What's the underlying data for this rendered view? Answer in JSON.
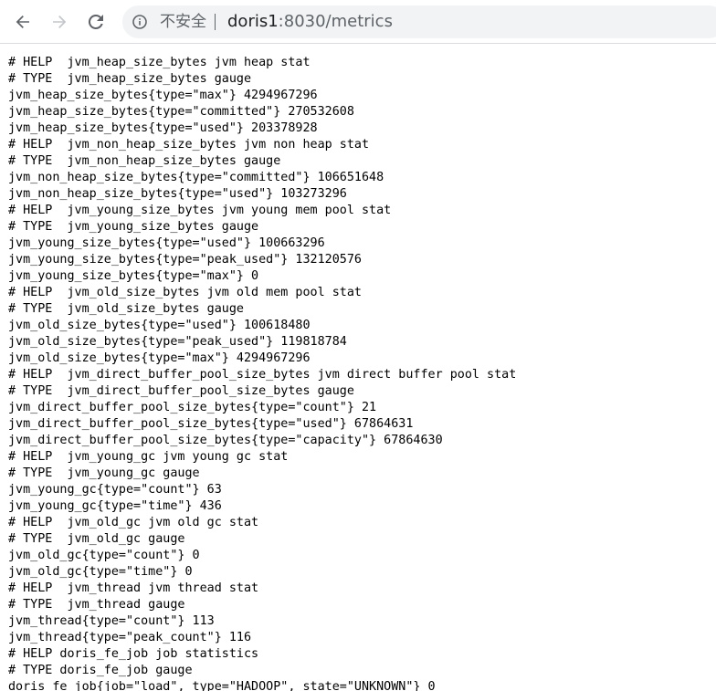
{
  "browser": {
    "back_icon": "arrow-left-icon",
    "forward_icon": "arrow-right-icon",
    "reload_icon": "reload-icon",
    "info_icon": "info-circle-icon",
    "security_label": "不安全",
    "url_host": "doris1",
    "url_rest": ":8030/metrics"
  },
  "content": {
    "lines": [
      "# HELP  jvm_heap_size_bytes jvm heap stat",
      "# TYPE  jvm_heap_size_bytes gauge",
      "jvm_heap_size_bytes{type=\"max\"} 4294967296",
      "jvm_heap_size_bytes{type=\"committed\"} 270532608",
      "jvm_heap_size_bytes{type=\"used\"} 203378928",
      "# HELP  jvm_non_heap_size_bytes jvm non heap stat",
      "# TYPE  jvm_non_heap_size_bytes gauge",
      "jvm_non_heap_size_bytes{type=\"committed\"} 106651648",
      "jvm_non_heap_size_bytes{type=\"used\"} 103273296",
      "# HELP  jvm_young_size_bytes jvm young mem pool stat",
      "# TYPE  jvm_young_size_bytes gauge",
      "jvm_young_size_bytes{type=\"used\"} 100663296",
      "jvm_young_size_bytes{type=\"peak_used\"} 132120576",
      "jvm_young_size_bytes{type=\"max\"} 0",
      "# HELP  jvm_old_size_bytes jvm old mem pool stat",
      "# TYPE  jvm_old_size_bytes gauge",
      "jvm_old_size_bytes{type=\"used\"} 100618480",
      "jvm_old_size_bytes{type=\"peak_used\"} 119818784",
      "jvm_old_size_bytes{type=\"max\"} 4294967296",
      "# HELP  jvm_direct_buffer_pool_size_bytes jvm direct buffer pool stat",
      "# TYPE  jvm_direct_buffer_pool_size_bytes gauge",
      "jvm_direct_buffer_pool_size_bytes{type=\"count\"} 21",
      "jvm_direct_buffer_pool_size_bytes{type=\"used\"} 67864631",
      "jvm_direct_buffer_pool_size_bytes{type=\"capacity\"} 67864630",
      "# HELP  jvm_young_gc jvm young gc stat",
      "# TYPE  jvm_young_gc gauge",
      "jvm_young_gc{type=\"count\"} 63",
      "jvm_young_gc{type=\"time\"} 436",
      "# HELP  jvm_old_gc jvm old gc stat",
      "# TYPE  jvm_old_gc gauge",
      "jvm_old_gc{type=\"count\"} 0",
      "jvm_old_gc{type=\"time\"} 0",
      "# HELP  jvm_thread jvm thread stat",
      "# TYPE  jvm_thread gauge",
      "jvm_thread{type=\"count\"} 113",
      "jvm_thread{type=\"peak_count\"} 116",
      "# HELP doris_fe_job job statistics",
      "# TYPE doris_fe_job gauge",
      "doris_fe_job{job=\"load\", type=\"HADOOP\", state=\"UNKNOWN\"} 0"
    ]
  }
}
